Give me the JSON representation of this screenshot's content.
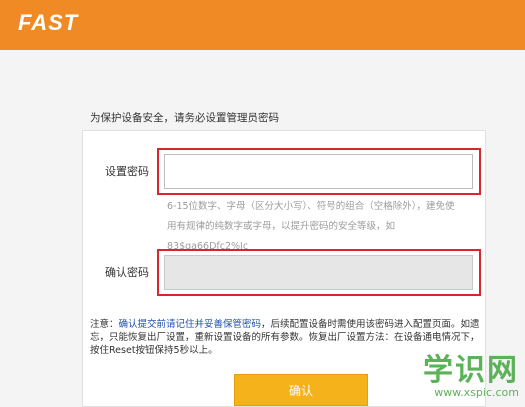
{
  "header": {
    "brand": "FAST",
    "bg_color": "#f08a24"
  },
  "form": {
    "intro": "为保护设备安全，请务必设置管理员密码",
    "password_label": "设置密码",
    "password_value": "",
    "hint": "6-15位数字、字母（区分大小写）、符号的组合（空格除外），建免使用有规律的纯数字或字母，以提升密码的安全等级，如83$qa66Dfc2%Jc",
    "confirm_label": "确认密码",
    "confirm_value": "",
    "note_prefix": "注意：",
    "note_highlight": "确认提交前请记住并妥善保管密码",
    "note_rest": "，后续配置设备时需使用该密码进入配置页面。如遗忘，只能恢复出厂设置，重新设置设备的所有参数。恢复出厂设置方法：在设备通电情况下，按住Reset按钮保持5秒以上。",
    "submit_label": "确认"
  },
  "watermark": {
    "text": "学识网",
    "url": "www.xspic.com"
  }
}
